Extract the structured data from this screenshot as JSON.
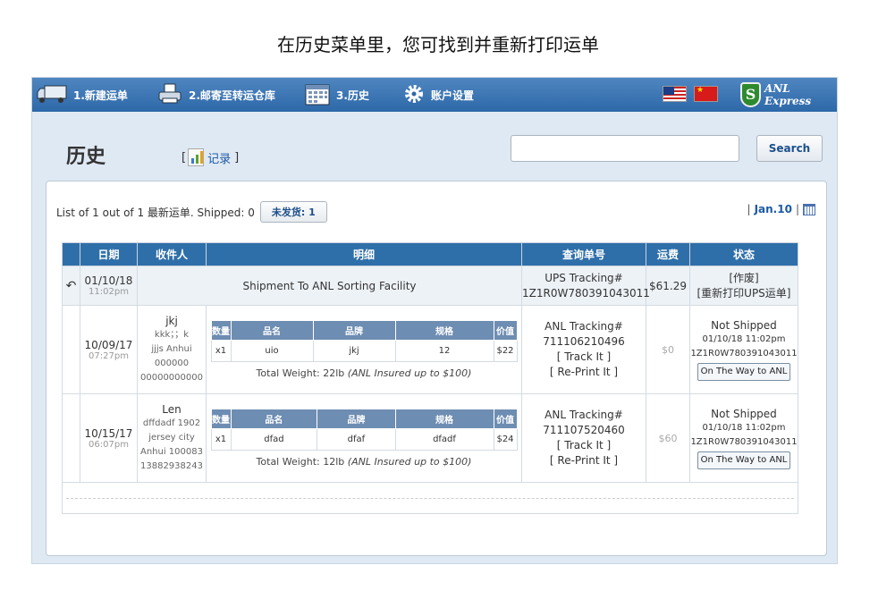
{
  "caption": "在历史菜单里，您可找到并重新打印运单",
  "nav": {
    "items": [
      {
        "label": "1.新建运单",
        "icon": "truck-icon"
      },
      {
        "label": "2.邮寄至转运仓库",
        "icon": "printer-icon"
      },
      {
        "label": "3.历史",
        "icon": "calendar-icon"
      },
      {
        "label": "账户设置",
        "icon": "gear-icon"
      }
    ],
    "brand": "ANL Express"
  },
  "page": {
    "title": "历史",
    "records_prefix": "[",
    "records_label": "记录",
    "records_suffix": "]",
    "search_button": "Search",
    "search_value": ""
  },
  "summary": {
    "text": "List of 1 out of 1 最新运单. Shipped: 0",
    "unshipped_button": "未发货: 1",
    "month_prefix": "|",
    "month": "Jan.10",
    "month_suffix": "|"
  },
  "table": {
    "headers": [
      "日期",
      "收件人",
      "明细",
      "查询单号",
      "运费",
      "状态"
    ],
    "consolidated": {
      "date": "01/10/18",
      "time": "11:02pm",
      "detail": "Shipment To ANL Sorting Facility",
      "tracking_label": "UPS Tracking#",
      "tracking_no": "1Z1R0W780391043011",
      "fee": "$61.29",
      "status_void": "[作废]",
      "status_reprint": "[重新打印UPS运单]"
    },
    "item_headers": [
      "数量",
      "品名",
      "品牌",
      "规格",
      "价值"
    ],
    "rows": [
      {
        "date": "10/09/17",
        "time": "07:27pm",
        "recipient_name": "jkj",
        "recipient_lines": [
          "kkk；；k",
          "jjjs Anhui",
          "000000",
          "00000000000"
        ],
        "item": {
          "qty": "x1",
          "name": "uio",
          "brand": "jkj",
          "spec": "12",
          "value": "$22"
        },
        "total_weight": "Total Weight: 22lb",
        "insured": "(ANL Insured up to $100)",
        "tracking_label": "ANL Tracking#",
        "tracking_no": "711106210496",
        "track_link": "[ Track It ]",
        "reprint_link": "[ Re-Print It ]",
        "fee": "$0",
        "status": "Not Shipped",
        "status_time": "01/10/18 11:02pm",
        "status_tracking": "1Z1R0W780391043011",
        "status_button": "On The Way to ANL"
      },
      {
        "date": "10/15/17",
        "time": "06:07pm",
        "recipient_name": "Len",
        "recipient_lines": [
          "dffdadf 1902",
          "jersey city",
          "Anhui 100083",
          "13882938243"
        ],
        "item": {
          "qty": "x1",
          "name": "dfad",
          "brand": "dfaf",
          "spec": "dfadf",
          "value": "$24"
        },
        "total_weight": "Total Weight: 12lb",
        "insured": "(ANL Insured up to $100)",
        "tracking_label": "ANL Tracking#",
        "tracking_no": "711107520460",
        "track_link": "[ Track It ]",
        "reprint_link": "[ Re-Print It ]",
        "fee": "$60",
        "status": "Not Shipped",
        "status_time": "01/10/18 11:02pm",
        "status_tracking": "1Z1R0W780391043011",
        "status_button": "On The Way to ANL"
      }
    ]
  }
}
